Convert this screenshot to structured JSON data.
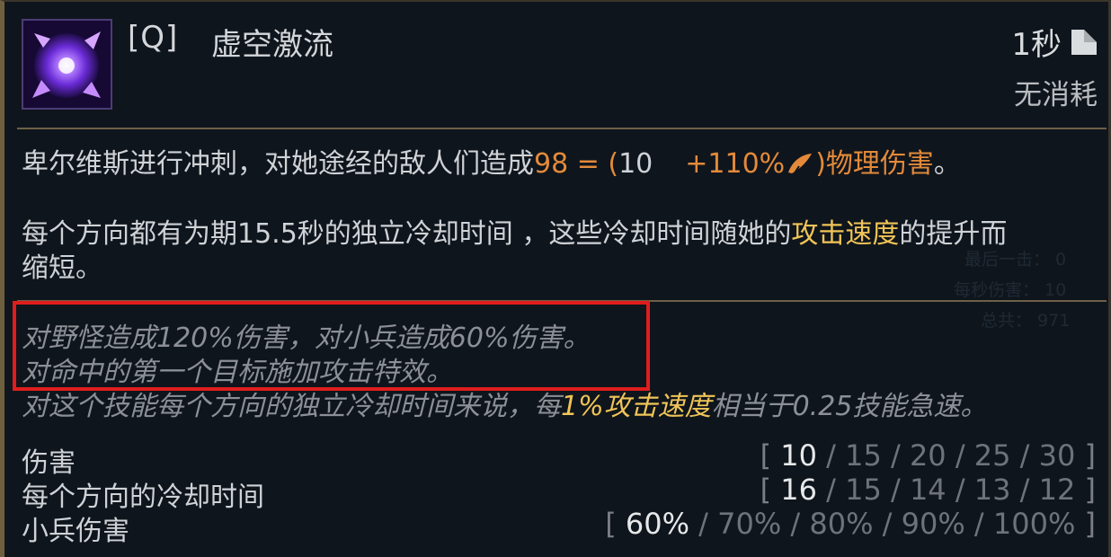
{
  "header": {
    "hotkey": "[Q]",
    "ability_name": "虚空激流",
    "cooldown": "1秒",
    "cost": "无消耗",
    "icon": "void-vortex-icon"
  },
  "description": {
    "line1_pre": "卑尔维斯进行冲刺，对她途经的敌人们造成",
    "line1_value": "98 = (",
    "line1_base": "10",
    "line1_scale": "+110%",
    "line1_post": ")物理伤害",
    "line1_end": "。",
    "line2_pre": "每个方向都有为期15.5秒的独立冷却时间 ，这些冷却时间随她的",
    "line2_keyword": "攻击速度",
    "line2_post": "的提升而",
    "line3": "缩短。"
  },
  "notes": {
    "line1": "对野怪造成120%伤害，对小兵造成60%伤害。",
    "line2": "对命中的第一个目标施加攻击特效。",
    "line3_pre": "对这个技能每个方向的独立冷却时间来说，每",
    "line3_keyword": "1%攻击速度",
    "line3_post": "相当于0.25技能急速。"
  },
  "stats": [
    {
      "label": "伤害",
      "values": [
        "10",
        "15",
        "20",
        "25",
        "30"
      ]
    },
    {
      "label": "每个方向的冷却时间",
      "values": [
        "16",
        "15",
        "14",
        "13",
        "12"
      ]
    },
    {
      "label": "小兵伤害",
      "values": [
        "60%",
        "70%",
        "80%",
        "90%",
        "100%"
      ]
    }
  ],
  "background_overlay": {
    "line1": "最后一击：  0",
    "line2": "每秒伤害：  10",
    "line3": "总共：  971"
  },
  "colors": {
    "damage_orange": "#e38a3a",
    "keyword_gold": "#f0c457",
    "highlight_box_red": "#e01d1d",
    "border_gold": "#6e5f3e"
  }
}
